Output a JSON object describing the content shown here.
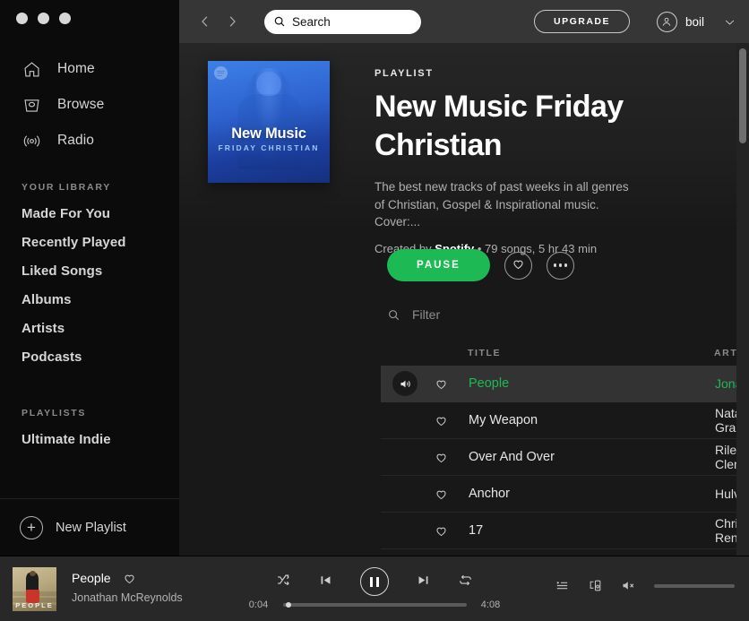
{
  "window": {
    "dots": [
      "close",
      "minimize",
      "maximize"
    ]
  },
  "sidebar": {
    "nav": [
      {
        "label": "Home",
        "icon": "home-icon"
      },
      {
        "label": "Browse",
        "icon": "browse-icon"
      },
      {
        "label": "Radio",
        "icon": "radio-icon"
      }
    ],
    "library_header": "YOUR LIBRARY",
    "library": [
      {
        "label": "Made For You"
      },
      {
        "label": "Recently Played"
      },
      {
        "label": "Liked Songs"
      },
      {
        "label": "Albums"
      },
      {
        "label": "Artists"
      },
      {
        "label": "Podcasts"
      }
    ],
    "playlists_header": "PLAYLISTS",
    "playlists": [
      {
        "label": "Ultimate Indie"
      }
    ],
    "new_playlist_label": "New Playlist"
  },
  "topbar": {
    "back_icon": "chevron-left-icon",
    "forward_icon": "chevron-right-icon",
    "search_placeholder": "Search",
    "search_value": "Search",
    "upgrade_label": "UPGRADE",
    "username": "boil",
    "user_chevron_icon": "chevron-down-icon"
  },
  "playlist": {
    "kicker": "PLAYLIST",
    "title": "New Music Friday\nChristian",
    "description": "The best new tracks of past weeks in all genres of Christian, Gospel & Inspirational music. Cover:...",
    "created_by_prefix": "Created by ",
    "owner": "Spotify",
    "meta_suffix": " • 79 songs, 5 hr 43 min",
    "song_count": "79 songs",
    "duration": "5 hr 43 min",
    "cover": {
      "title": "New Music",
      "subtitle": "FRIDAY CHRISTIAN"
    },
    "play_button_label": "PAUSE",
    "like_icon": "heart-icon",
    "more_icon": "ellipsis-icon",
    "filter_placeholder": "Filter"
  },
  "tracklist": {
    "columns": {
      "title": "TITLE",
      "artist": "ARTIST"
    },
    "rows": [
      {
        "title": "People",
        "artist": "Jonathan McR...",
        "playing": true
      },
      {
        "title": "My Weapon",
        "artist": "Natalie Grant",
        "playing": false
      },
      {
        "title": "Over And Over",
        "artist": "Riley Clemmons",
        "playing": false
      },
      {
        "title": "Anchor",
        "artist": "Hulvey",
        "playing": false
      },
      {
        "title": "17",
        "artist": "Chris Renzema",
        "playing": false
      }
    ]
  },
  "player": {
    "track_title": "People",
    "track_artist": "Jonathan McReynolds",
    "art_text": "PEOPLE",
    "elapsed": "0:04",
    "total": "4:08",
    "progress_percent": 1.6,
    "volume_percent": 0,
    "shuffle_icon": "shuffle-icon",
    "previous_icon": "previous-icon",
    "pause_icon": "pause-icon",
    "next_icon": "next-icon",
    "repeat_icon": "repeat-icon",
    "queue_icon": "queue-icon",
    "devices_icon": "devices-icon",
    "volume_icon": "volume-muted-icon",
    "favorite_icon": "heart-icon"
  },
  "colors": {
    "accent": "#1db954",
    "sidebar_bg": "#0b0b0b",
    "main_bg": "#181818",
    "player_bg": "#282828",
    "topbar_bg": "#363636"
  }
}
